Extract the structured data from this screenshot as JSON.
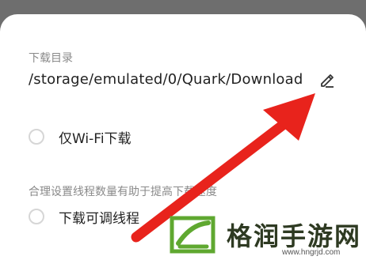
{
  "download": {
    "section_label": "下载目录",
    "path": "/storage/emulated/0/Quark/Download",
    "edit_icon": "pencil-icon"
  },
  "options": {
    "wifi_only_label": "仅Wi-Fi下载",
    "thread_hint": "合理设置线程数量有助于提高下载速度",
    "adjustable_threads_label": "下载可调线程"
  },
  "overlay": {
    "arrow_color": "#e8231c",
    "watermark_text": "格润手游网",
    "watermark_url": "www.hngrjd.com",
    "watermark_color": "#2e3a22",
    "logo_color": "#5fa830"
  }
}
